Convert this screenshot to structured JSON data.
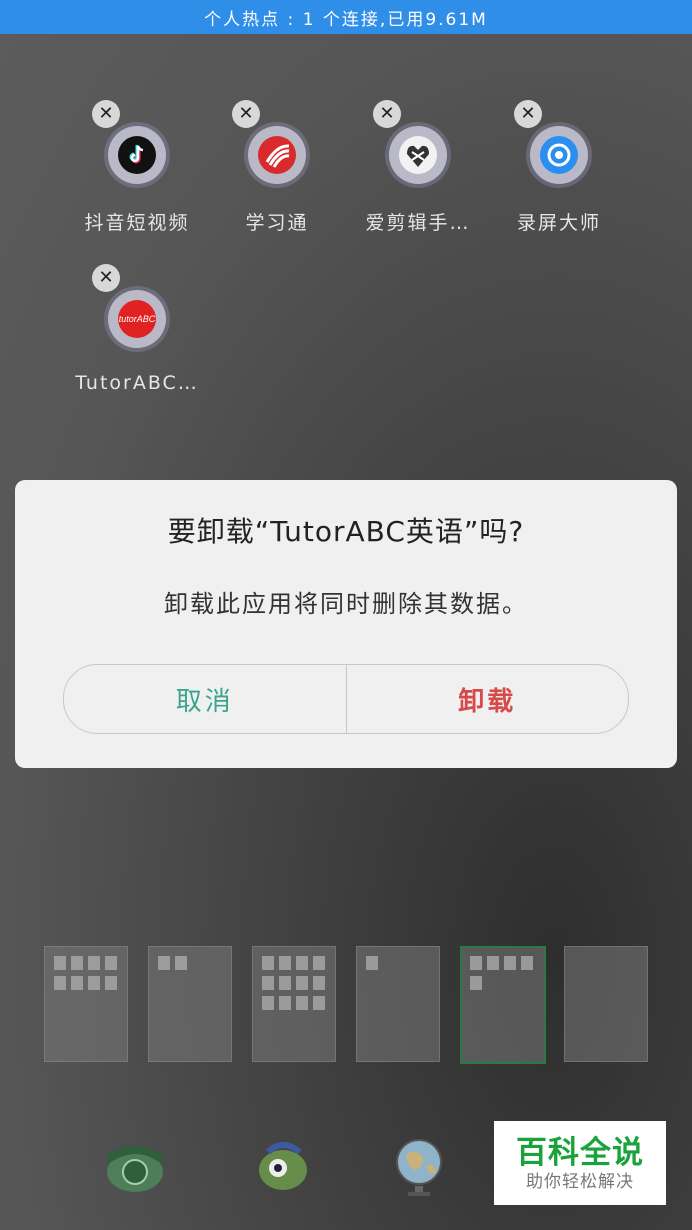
{
  "status_bar": {
    "text": "个人热点 : 1 个连接,已用9.61M"
  },
  "apps": [
    {
      "label": "抖音短视频",
      "icon": "tiktok-icon"
    },
    {
      "label": "学习通",
      "icon": "xuexitong-icon"
    },
    {
      "label": "爱剪辑手…",
      "icon": "ijianji-icon"
    },
    {
      "label": "录屏大师",
      "icon": "screen-recorder-icon"
    },
    {
      "label": "TutorABC…",
      "icon": "tutorabc-icon"
    }
  ],
  "dialog": {
    "title": "要卸载“TutorABC英语”吗?",
    "message": "卸载此应用将同时删除其数据。",
    "cancel_label": "取消",
    "uninstall_label": "卸载"
  },
  "dock": [
    {
      "icon": "telephone-icon"
    },
    {
      "icon": "monster-icon"
    },
    {
      "icon": "globe-icon"
    }
  ],
  "watermark": {
    "title": "百科全说",
    "subtitle": "助你轻松解决"
  },
  "colors": {
    "status_bar": "#2f8ee8",
    "cancel": "#3aa58c",
    "uninstall": "#d84a4a",
    "watermark_green": "#1aa33a"
  }
}
